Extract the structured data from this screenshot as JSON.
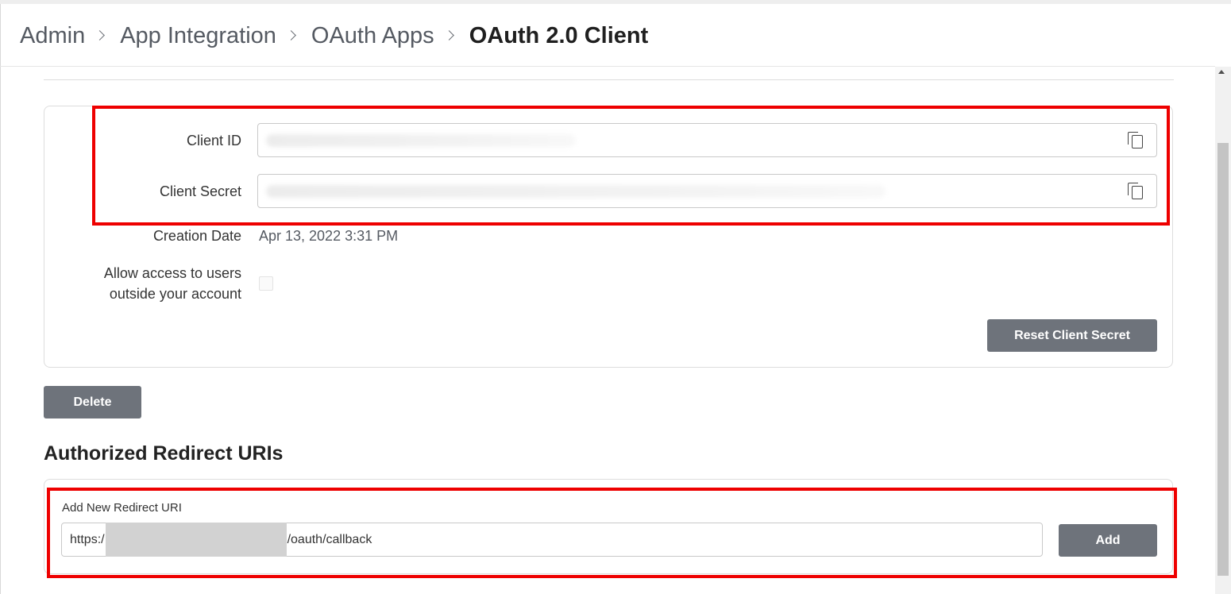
{
  "breadcrumb": {
    "items": [
      "Admin",
      "App Integration",
      "OAuth Apps"
    ],
    "current": "OAuth 2.0 Client"
  },
  "credentials": {
    "client_id_label": "Client ID",
    "client_secret_label": "Client Secret",
    "creation_date_label": "Creation Date",
    "creation_date_value": "Apr 13, 2022 3:31 PM",
    "allow_access_label_line1": "Allow access to users",
    "allow_access_label_line2": "outside your account",
    "allow_access_checked": false,
    "reset_button": "Reset Client Secret"
  },
  "delete_button": "Delete",
  "redirects": {
    "title": "Authorized Redirect URIs",
    "add_label": "Add New Redirect URI",
    "value_prefix": "https:/",
    "value_suffix": "/oauth/callback",
    "add_button": "Add"
  },
  "colors": {
    "button_gray": "#6e737b",
    "highlight_red": "#ee0000"
  },
  "icons": {
    "copy": "copy-icon",
    "breadcrumb_separator": "chevron-right-icon"
  }
}
